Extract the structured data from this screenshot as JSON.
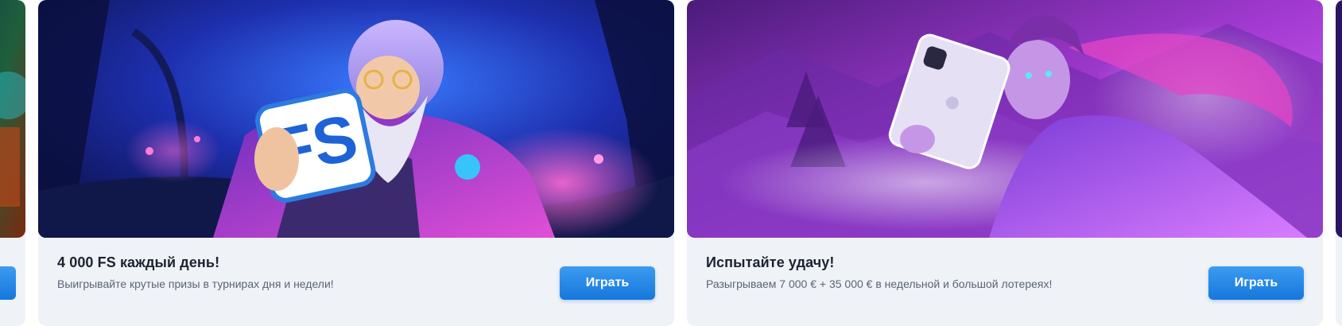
{
  "promos": [
    {
      "title": "4 000 FS каждый день!",
      "description": "Выигрывайте крутые призы в турнирах дня и недели!",
      "button_label": "Играть",
      "badge_text": "FS",
      "accent_color": "#1677dd"
    },
    {
      "title": "Испытайте удачу!",
      "description": "Разыгрываем 7 000 € + 35 000 € в недельной и большой лотереях!",
      "button_label": "Играть",
      "accent_color": "#1677dd"
    }
  ],
  "icons": {
    "card1": "wizard-fs-illustration",
    "card2": "sorceress-tablet-illustration"
  }
}
